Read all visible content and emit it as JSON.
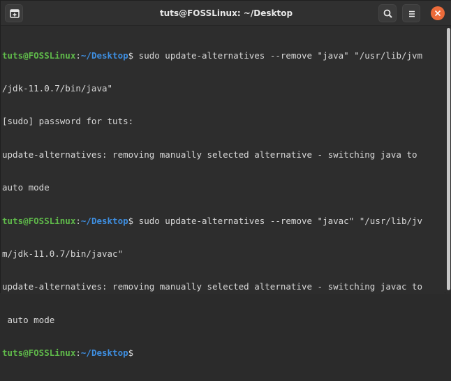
{
  "window": {
    "title": "tuts@FOSSLinux: ~/Desktop",
    "accent_close": "#ec6b3a"
  },
  "icons": {
    "new_tab": "new-tab-icon",
    "search": "search-icon",
    "menu": "hamburger-menu-icon",
    "close": "close-icon"
  },
  "prompt": {
    "user": "tuts@FOSSLinux",
    "colon": ":",
    "path": "~/Desktop",
    "dollar": "$"
  },
  "lines": [
    {
      "type": "prompt",
      "cmd": " sudo update-alternatives --remove \"java\" \"/usr/lib/jvm"
    },
    {
      "type": "text",
      "text": "/jdk-11.0.7/bin/java\""
    },
    {
      "type": "text",
      "text": "[sudo] password for tuts:"
    },
    {
      "type": "text",
      "text": "update-alternatives: removing manually selected alternative - switching java to"
    },
    {
      "type": "text",
      "text": "auto mode"
    },
    {
      "type": "prompt",
      "cmd": " sudo update-alternatives --remove \"javac\" \"/usr/lib/jv"
    },
    {
      "type": "text",
      "text": "m/jdk-11.0.7/bin/javac\""
    },
    {
      "type": "text",
      "text": "update-alternatives: removing manually selected alternative - switching javac to"
    },
    {
      "type": "text",
      "text": " auto mode"
    },
    {
      "type": "prompt",
      "cmd": ""
    }
  ]
}
